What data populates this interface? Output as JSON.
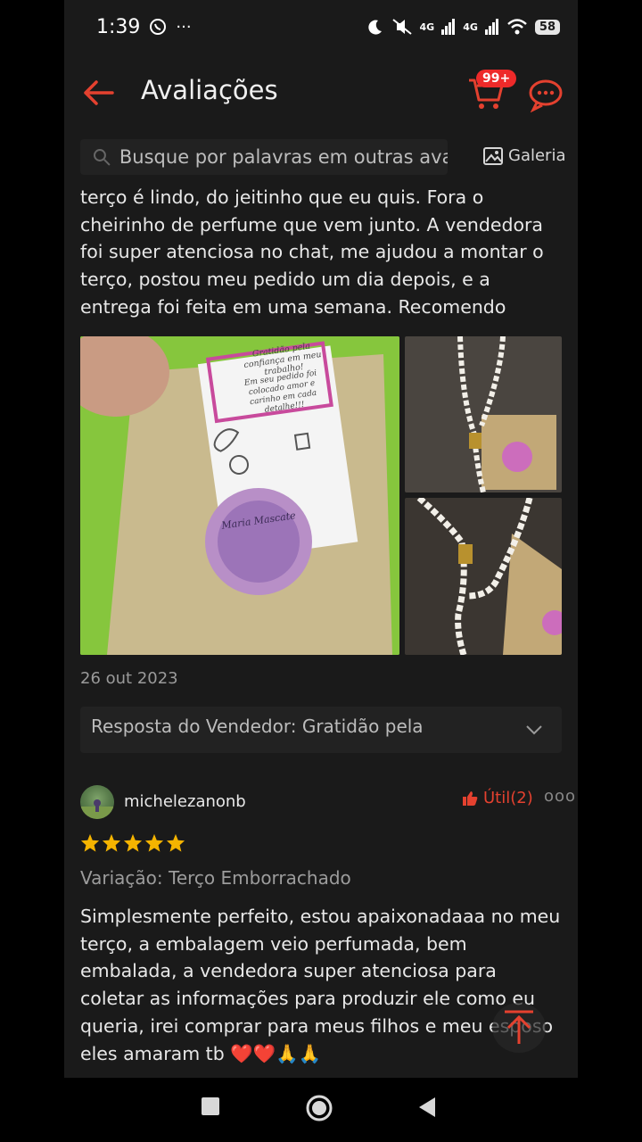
{
  "status_bar": {
    "time": "1:39",
    "network_1": "4G",
    "network_2": "4G",
    "battery": "58"
  },
  "header": {
    "title": "Avaliações",
    "cart_badge": "99+"
  },
  "search": {
    "placeholder": "Busque por palavras em outras aval",
    "gallery_label": "Galeria"
  },
  "review_1": {
    "text": "terço é lindo, do jeitinho que eu quis. Fora o cheirinho de perfume que vem junto. A vendedora foi super atenciosa no chat, me ajudou a montar o terço, postou meu pedido um dia depois, e a entrega foi feita em uma semana. Recomendo muito ❤️",
    "card_text": {
      "title": "Gratidão pela confiança em meu trabalho!",
      "body": "Em seu pedido foi colocado amor e carinho em cada detalhe!!!",
      "brand": "Maria Mascate"
    },
    "date": "26 out 2023",
    "seller_reply_label": "Resposta do Vendedor:",
    "seller_reply_text": "Gratidão pela"
  },
  "review_2": {
    "username": "michelezanonb",
    "useful_label": "Útil(2)",
    "rating": 5,
    "variation": "Variação: Terço Emborrachado",
    "text": "Simplesmente perfeito, estou apaixonadaaa no meu terço, a embalagem veio perfumada, bem embalada, a vendedora super atenciosa para coletar as informações para produzir ele como eu queria, irei comprar para meus filhos e meu esposo eles amaram tb ❤️❤️🙏🙏"
  },
  "colors": {
    "accent": "#e4412f",
    "background": "#1a1a1a",
    "star": "#f5b400"
  }
}
